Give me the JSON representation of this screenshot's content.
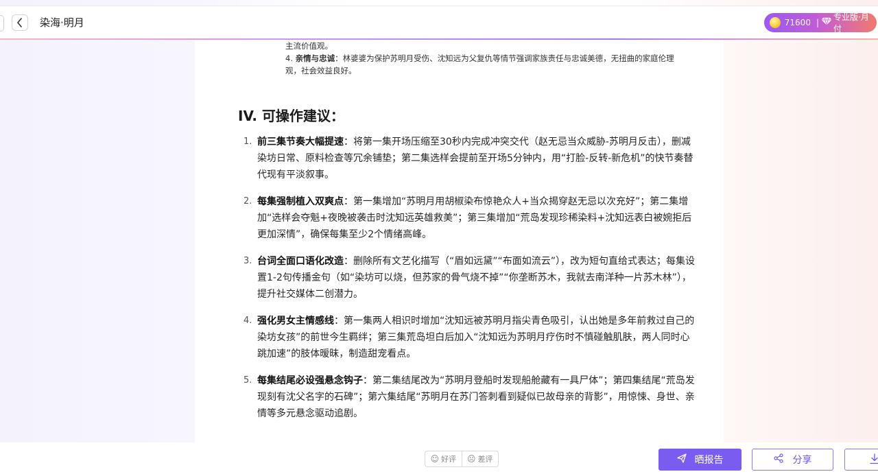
{
  "header": {
    "title": "染海·明月",
    "points": "71600",
    "separator": "|",
    "plan": "专业版·月付"
  },
  "doc": {
    "top_lines": [
      "主流价值观。",
      "观，社会效益良好。"
    ],
    "top_item": {
      "num": "4.",
      "bold": "亲情与忠诚",
      "text": "：林婆婆为保护苏明月受伤、沈知远为父复仇等情节强调家族责任与忠诚美德，无扭曲的家庭伦理"
    },
    "section_heading": "IV. 可操作建议：",
    "items": [
      {
        "num": "1.",
        "bold": "前三集节奏大幅提速",
        "text": "：将第一集开场压缩至30秒内完成冲突交代（赵无忌当众威胁-苏明月反击），删减染坊日常、原料检查等冗余铺垫；第二集选样会提前至开场5分钟内，用“打脸-反转-新危机”的快节奏替代现有平淡叙事。"
      },
      {
        "num": "2.",
        "bold": "每集强制植入双爽点",
        "text": "：第一集增加“苏明月用胡椒染布惊艳众人+当众揭穿赵无忌以次充好”；第二集增加“选样会夺魁+夜晚被袭击时沈知远英雄救美”；第三集增加“荒岛发现珍稀染料+沈知远表白被婉拒后更加深情”，确保每集至少2个情绪高峰。"
      },
      {
        "num": "3.",
        "bold": "台词全面口语化改造",
        "text": "：删除所有文艺化描写（“眉如远黛”“布面如流云”），改为短句直给式表达；每集设置1-2句传播金句（如“染坊可以烧，但苏家的骨气烧不掉”“你垄断苏木，我就去南洋种一片苏木林”），提升社交媒体二创潜力。"
      },
      {
        "num": "4.",
        "bold": "强化男女主情感线",
        "text": "：第一集两人相识时增加“沈知远被苏明月指尖青色吸引，认出她是多年前救过自己的染坊女孩”的前世今生羁绊；第三集荒岛坦白后加入“沈知远为苏明月疗伤时不慎碰触肌肤，两人同时心跳加速”的肢体暧昧，制造甜宠看点。"
      },
      {
        "num": "5.",
        "bold": "每集结尾必设强悬念钩子",
        "text": "：第二集结尾改为“苏明月登船时发现船舱藏有一具尸体”；第四集结尾“荒岛发现刻有沈父名字的石碑”；第六集结尾“苏明月在苏门答刺看到疑似已故母亲的背影”，用惊悚、身世、亲情等多元悬念驱动追剧。"
      }
    ]
  },
  "footer": {
    "good_label": "好评",
    "bad_label": "差评",
    "share_report_label": "晒报告",
    "share_label": "分享"
  },
  "colors": {
    "accent": "#7a5cf0",
    "vip_gradient_start": "#9b5af2",
    "vip_gradient_end": "#f07a6f"
  },
  "icons": {
    "back": "chevron-left-icon",
    "coin": "coin-icon",
    "vip": "diamond-icon",
    "smile": "smile-icon",
    "frown": "frown-icon",
    "send": "send-icon",
    "share": "share-icon",
    "download": "download-icon"
  }
}
